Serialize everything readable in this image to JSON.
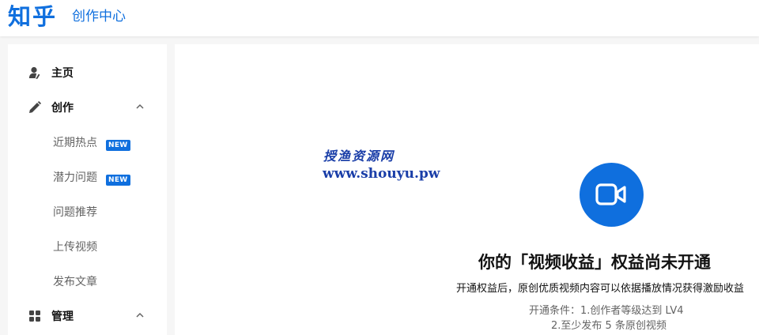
{
  "header": {
    "logo": "知乎",
    "subtitle": "创作中心"
  },
  "sidebar": {
    "items": [
      {
        "label": "主页",
        "icon": "user-icon"
      },
      {
        "label": "创作",
        "icon": "pencil-icon",
        "expanded": true
      },
      {
        "label": "管理",
        "icon": "grid-icon",
        "expanded": true
      }
    ],
    "sub_items": [
      {
        "label": "近期热点",
        "badge": "NEW"
      },
      {
        "label": "潜力问题",
        "badge": "NEW"
      },
      {
        "label": "问题推荐"
      },
      {
        "label": "上传视频"
      },
      {
        "label": "发布文章"
      }
    ]
  },
  "watermark": {
    "cn": "授渔资源网",
    "url": "www.shouyu.pw"
  },
  "main": {
    "icon": "video-camera-icon",
    "headline": "你的「视频收益」权益尚未开通",
    "description": "开通权益后，原创优质视频内容可以依据播放情况获得激励收益",
    "condition_line1": "开通条件：1.创作者等级达到 LV4",
    "condition_line2": "2.至少发布 5 条原创视频"
  },
  "colors": {
    "brand": "#0f6fde",
    "watermark": "#1a3ea8",
    "text_primary": "#121212",
    "text_secondary": "#646464"
  }
}
